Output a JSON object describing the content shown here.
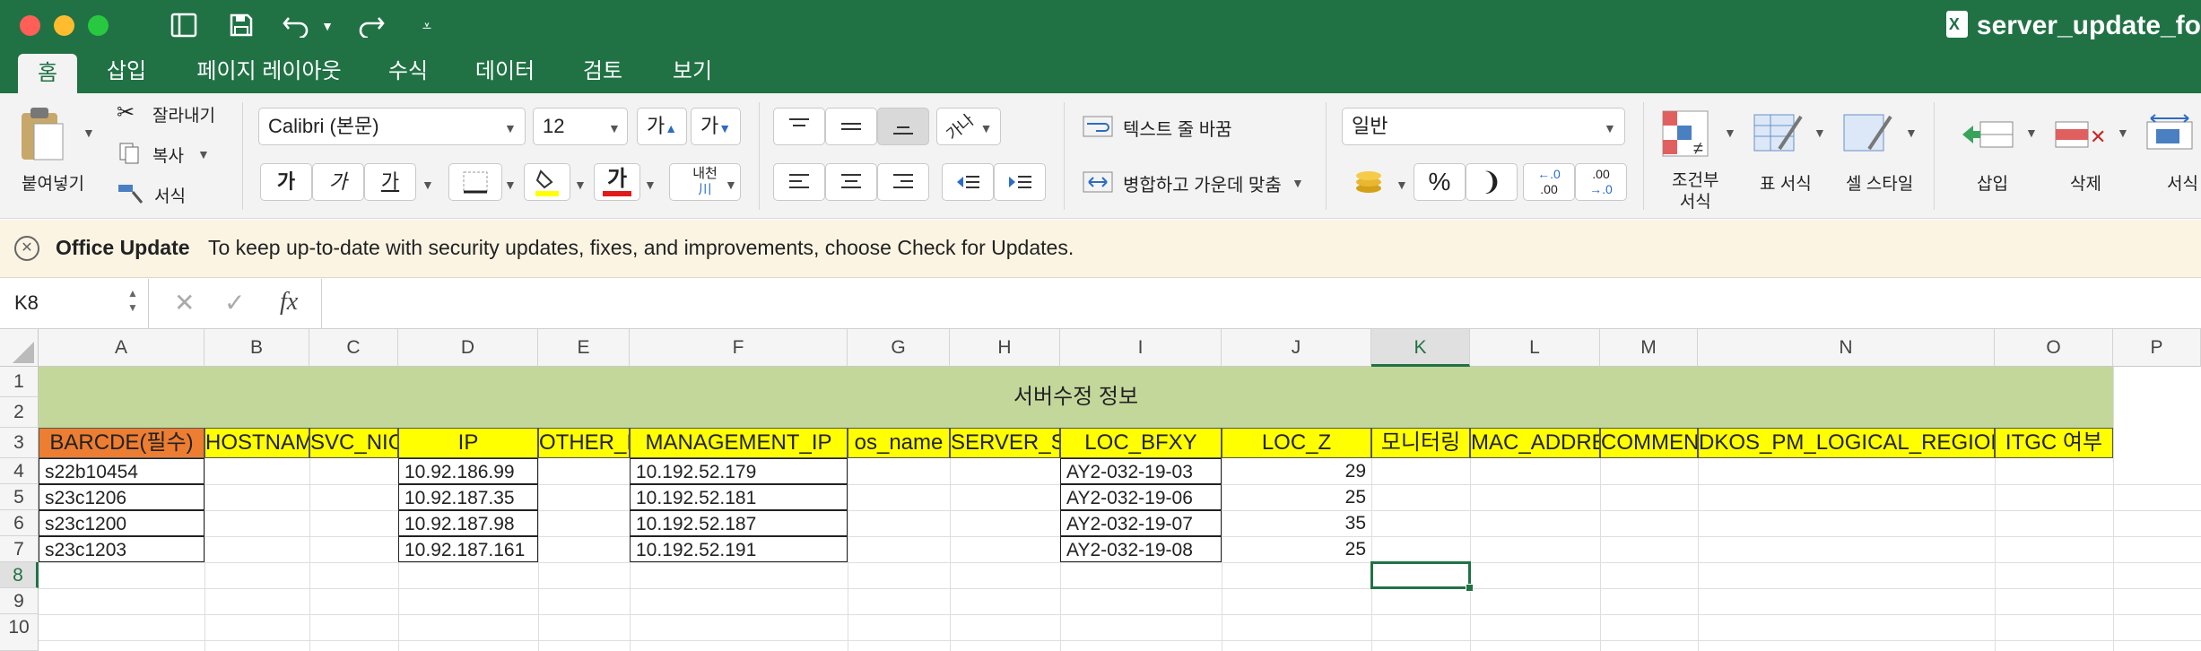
{
  "window": {
    "title": "server_update_fo"
  },
  "toolbar": {
    "undo_icon": "undo-icon",
    "redo_icon": "redo-icon"
  },
  "tabs": [
    "홈",
    "삽입",
    "페이지 레이아웃",
    "수식",
    "데이터",
    "검토",
    "보기"
  ],
  "ribbon": {
    "paste_label": "붙여넣기",
    "cut_label": "잘라내기",
    "copy_label": "복사",
    "format_painter_label": "서식",
    "font_name": "Calibri (본문)",
    "font_size": "12",
    "grow_font": "가",
    "shrink_font": "가",
    "bold": "가",
    "italic": "가",
    "underline": "가",
    "font_color_char": "가",
    "phonetic_top": "내천",
    "phonetic_bottom": "川",
    "wrap_text": "텍스트 줄 바꿈",
    "merge_center": "병합하고 가운데 맞춤",
    "number_format": "일반",
    "percent": "%",
    "comma": "❩",
    "increase_decimal_top": "←.0",
    "increase_decimal_bottom": ".00",
    "decrease_decimal_top": ".00",
    "decrease_decimal_bottom": "→.0",
    "conditional_format_line1": "조건부",
    "conditional_format_line2": "서식",
    "table_format": "표 서식",
    "cell_style": "셀 스타일",
    "insert": "삽입",
    "delete": "삭제",
    "format": "서식"
  },
  "update_bar": {
    "title": "Office Update",
    "message": "To keep up-to-date with security updates, fixes, and improvements, choose Check for Updates."
  },
  "formula_bar": {
    "name_box": "K8",
    "fx": "fx",
    "value": ""
  },
  "sheet": {
    "columns": [
      "A",
      "B",
      "C",
      "D",
      "E",
      "F",
      "G",
      "H",
      "I",
      "J",
      "K",
      "L",
      "M",
      "N",
      "O",
      "P"
    ],
    "rows": [
      "1",
      "2",
      "3",
      "4",
      "5",
      "6",
      "7",
      "8",
      "9",
      "10"
    ],
    "merged_title": "서버수정 정보",
    "headers": [
      "BARCDE(필수)",
      "HOSTNAME",
      "SVC_NICK",
      "IP",
      "OTHER_IP",
      "MANAGEMENT_IP",
      "os_name",
      "SERVER_STATUS",
      "LOC_BFXY",
      "LOC_Z",
      "모니터링",
      "MAC_ADDRESS",
      "COMMENT",
      "DKOS_PM_LOGICAL_REGION",
      "ITGC 여부"
    ],
    "data": [
      {
        "barcode": "s22b10454",
        "ip": "10.92.186.99",
        "mgmt_ip": "10.192.52.179",
        "loc": "AY2-032-19-03",
        "z": "29"
      },
      {
        "barcode": "s23c1206",
        "ip": "10.92.187.35",
        "mgmt_ip": "10.192.52.181",
        "loc": "AY2-032-19-06",
        "z": "25"
      },
      {
        "barcode": "s23c1200",
        "ip": "10.92.187.98",
        "mgmt_ip": "10.192.52.187",
        "loc": "AY2-032-19-07",
        "z": "35"
      },
      {
        "barcode": "s23c1203",
        "ip": "10.92.187.161",
        "mgmt_ip": "10.192.52.191",
        "loc": "AY2-032-19-08",
        "z": "25"
      }
    ]
  },
  "colors": {
    "excel_green": "#207245",
    "title_fill": "#c4d79b",
    "header_fill": "#ffff00",
    "barcode_fill": "#ed7d31"
  }
}
